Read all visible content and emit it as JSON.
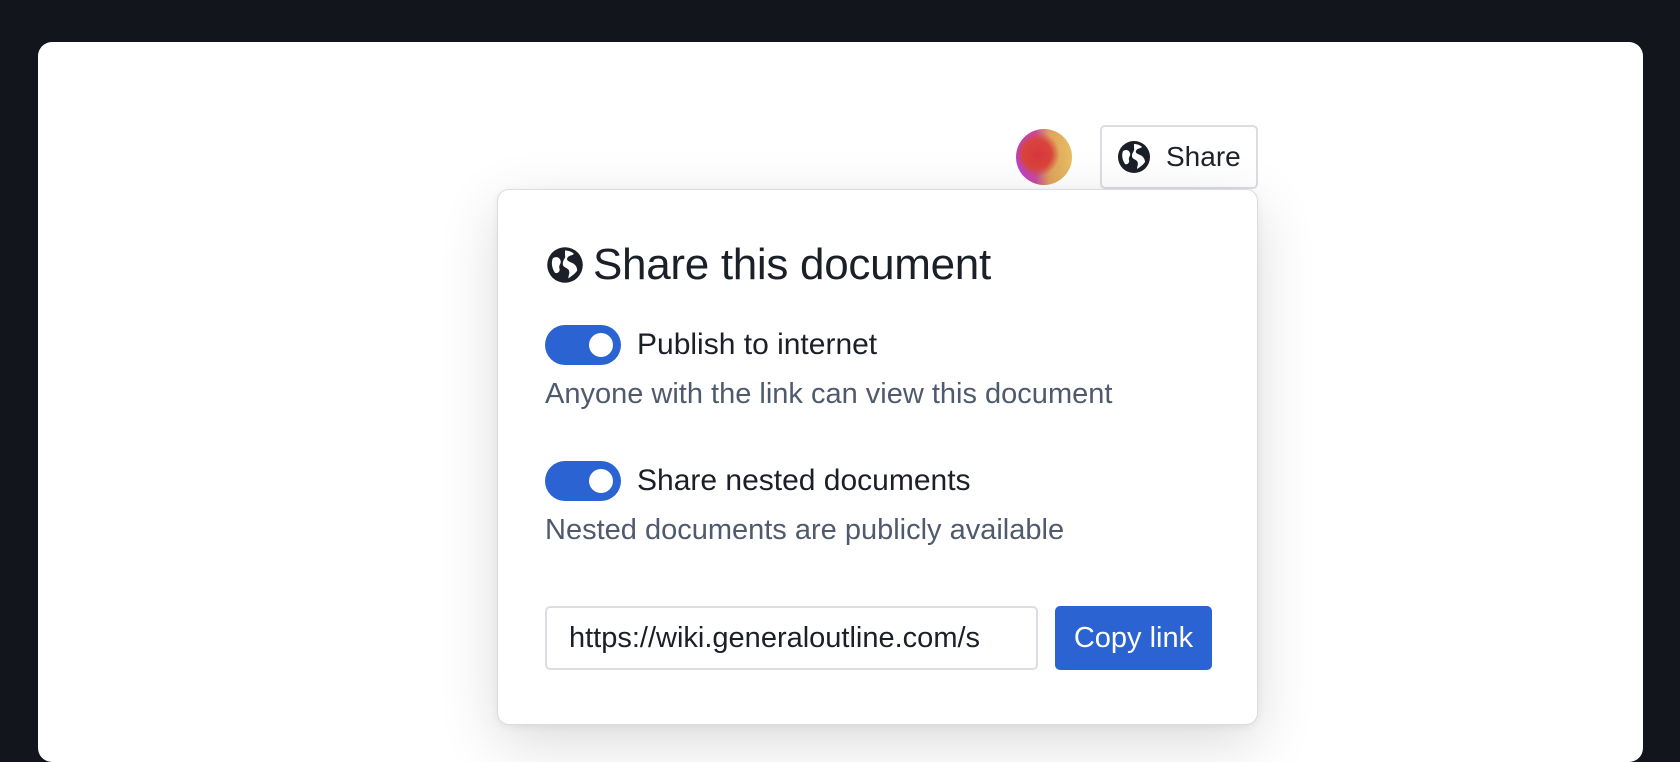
{
  "header": {
    "share_button_label": "Share",
    "share_icon": "globe-icon",
    "avatar": "user-avatar"
  },
  "popover": {
    "title": "Share this document",
    "title_icon": "globe-icon",
    "publish": {
      "label": "Publish to internet",
      "description": "Anyone with the link can view this document",
      "enabled": true
    },
    "nested": {
      "label": "Share nested documents",
      "description": "Nested documents are publicly available",
      "enabled": true
    },
    "link": {
      "value": "https://wiki.generaloutline.com/s",
      "copy_label": "Copy link"
    }
  },
  "colors": {
    "accent": "#2b63d2",
    "background": "#13151c",
    "text_primary": "#1b1f27",
    "text_secondary": "#4f5a6e",
    "border": "#dcdde3"
  }
}
